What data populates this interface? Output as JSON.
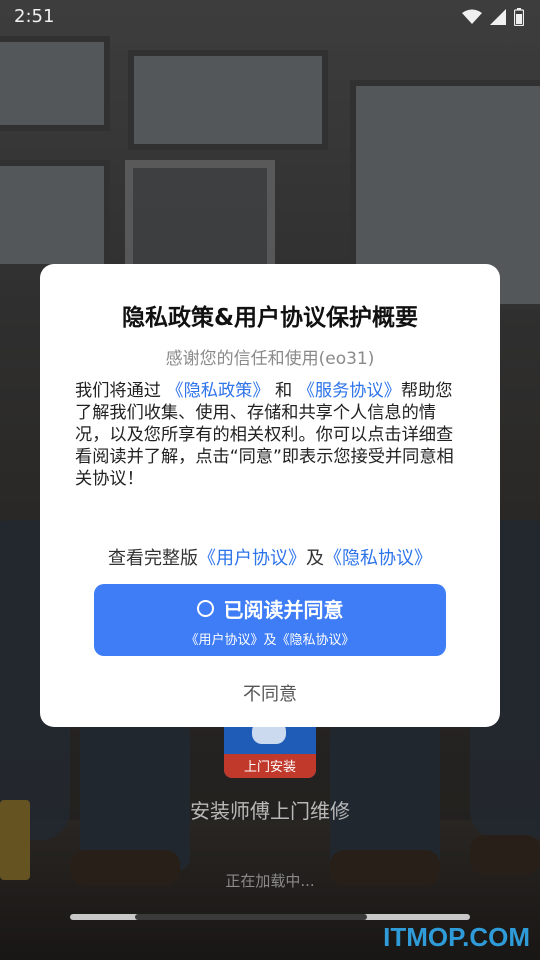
{
  "status_bar": {
    "time": "2:51",
    "icons": [
      "wifi-icon",
      "signal-icon",
      "battery-icon"
    ]
  },
  "dialog": {
    "title": "隐私政策&用户协议保护概要",
    "subtitle": "感谢您的信任和使用(eo31)",
    "body": {
      "part1": "我们将通过",
      "link_privacy": "《隐私政策》",
      "and": "和",
      "link_service": "《服务协议》",
      "part2": "帮助您了解我们收集、使用、存储和共享个人信息的情况，以及您所享有的相关权利。你可以点击详细查看阅读并了解，点击“同意”即表示您接受并同意相关协议！"
    },
    "full_version": {
      "prefix": "查看完整版",
      "link_user": "《用户协议》",
      "and": "及",
      "link_privacy": "《隐私协议》"
    },
    "agree_button": {
      "label": "已阅读并同意",
      "sub_label": "《用户协议》及《隐私协议》"
    },
    "disagree_label": "不同意"
  },
  "splash": {
    "logo_text": "上门安装",
    "app_title": "安装师傅上门维修",
    "loading_text": "正在加载中...",
    "progress_fraction": 0.58
  },
  "watermark": "ITMOP.COM",
  "colors": {
    "accent": "#3f7df7",
    "link": "#2e74ea",
    "watermark": "#2f9bd8"
  }
}
